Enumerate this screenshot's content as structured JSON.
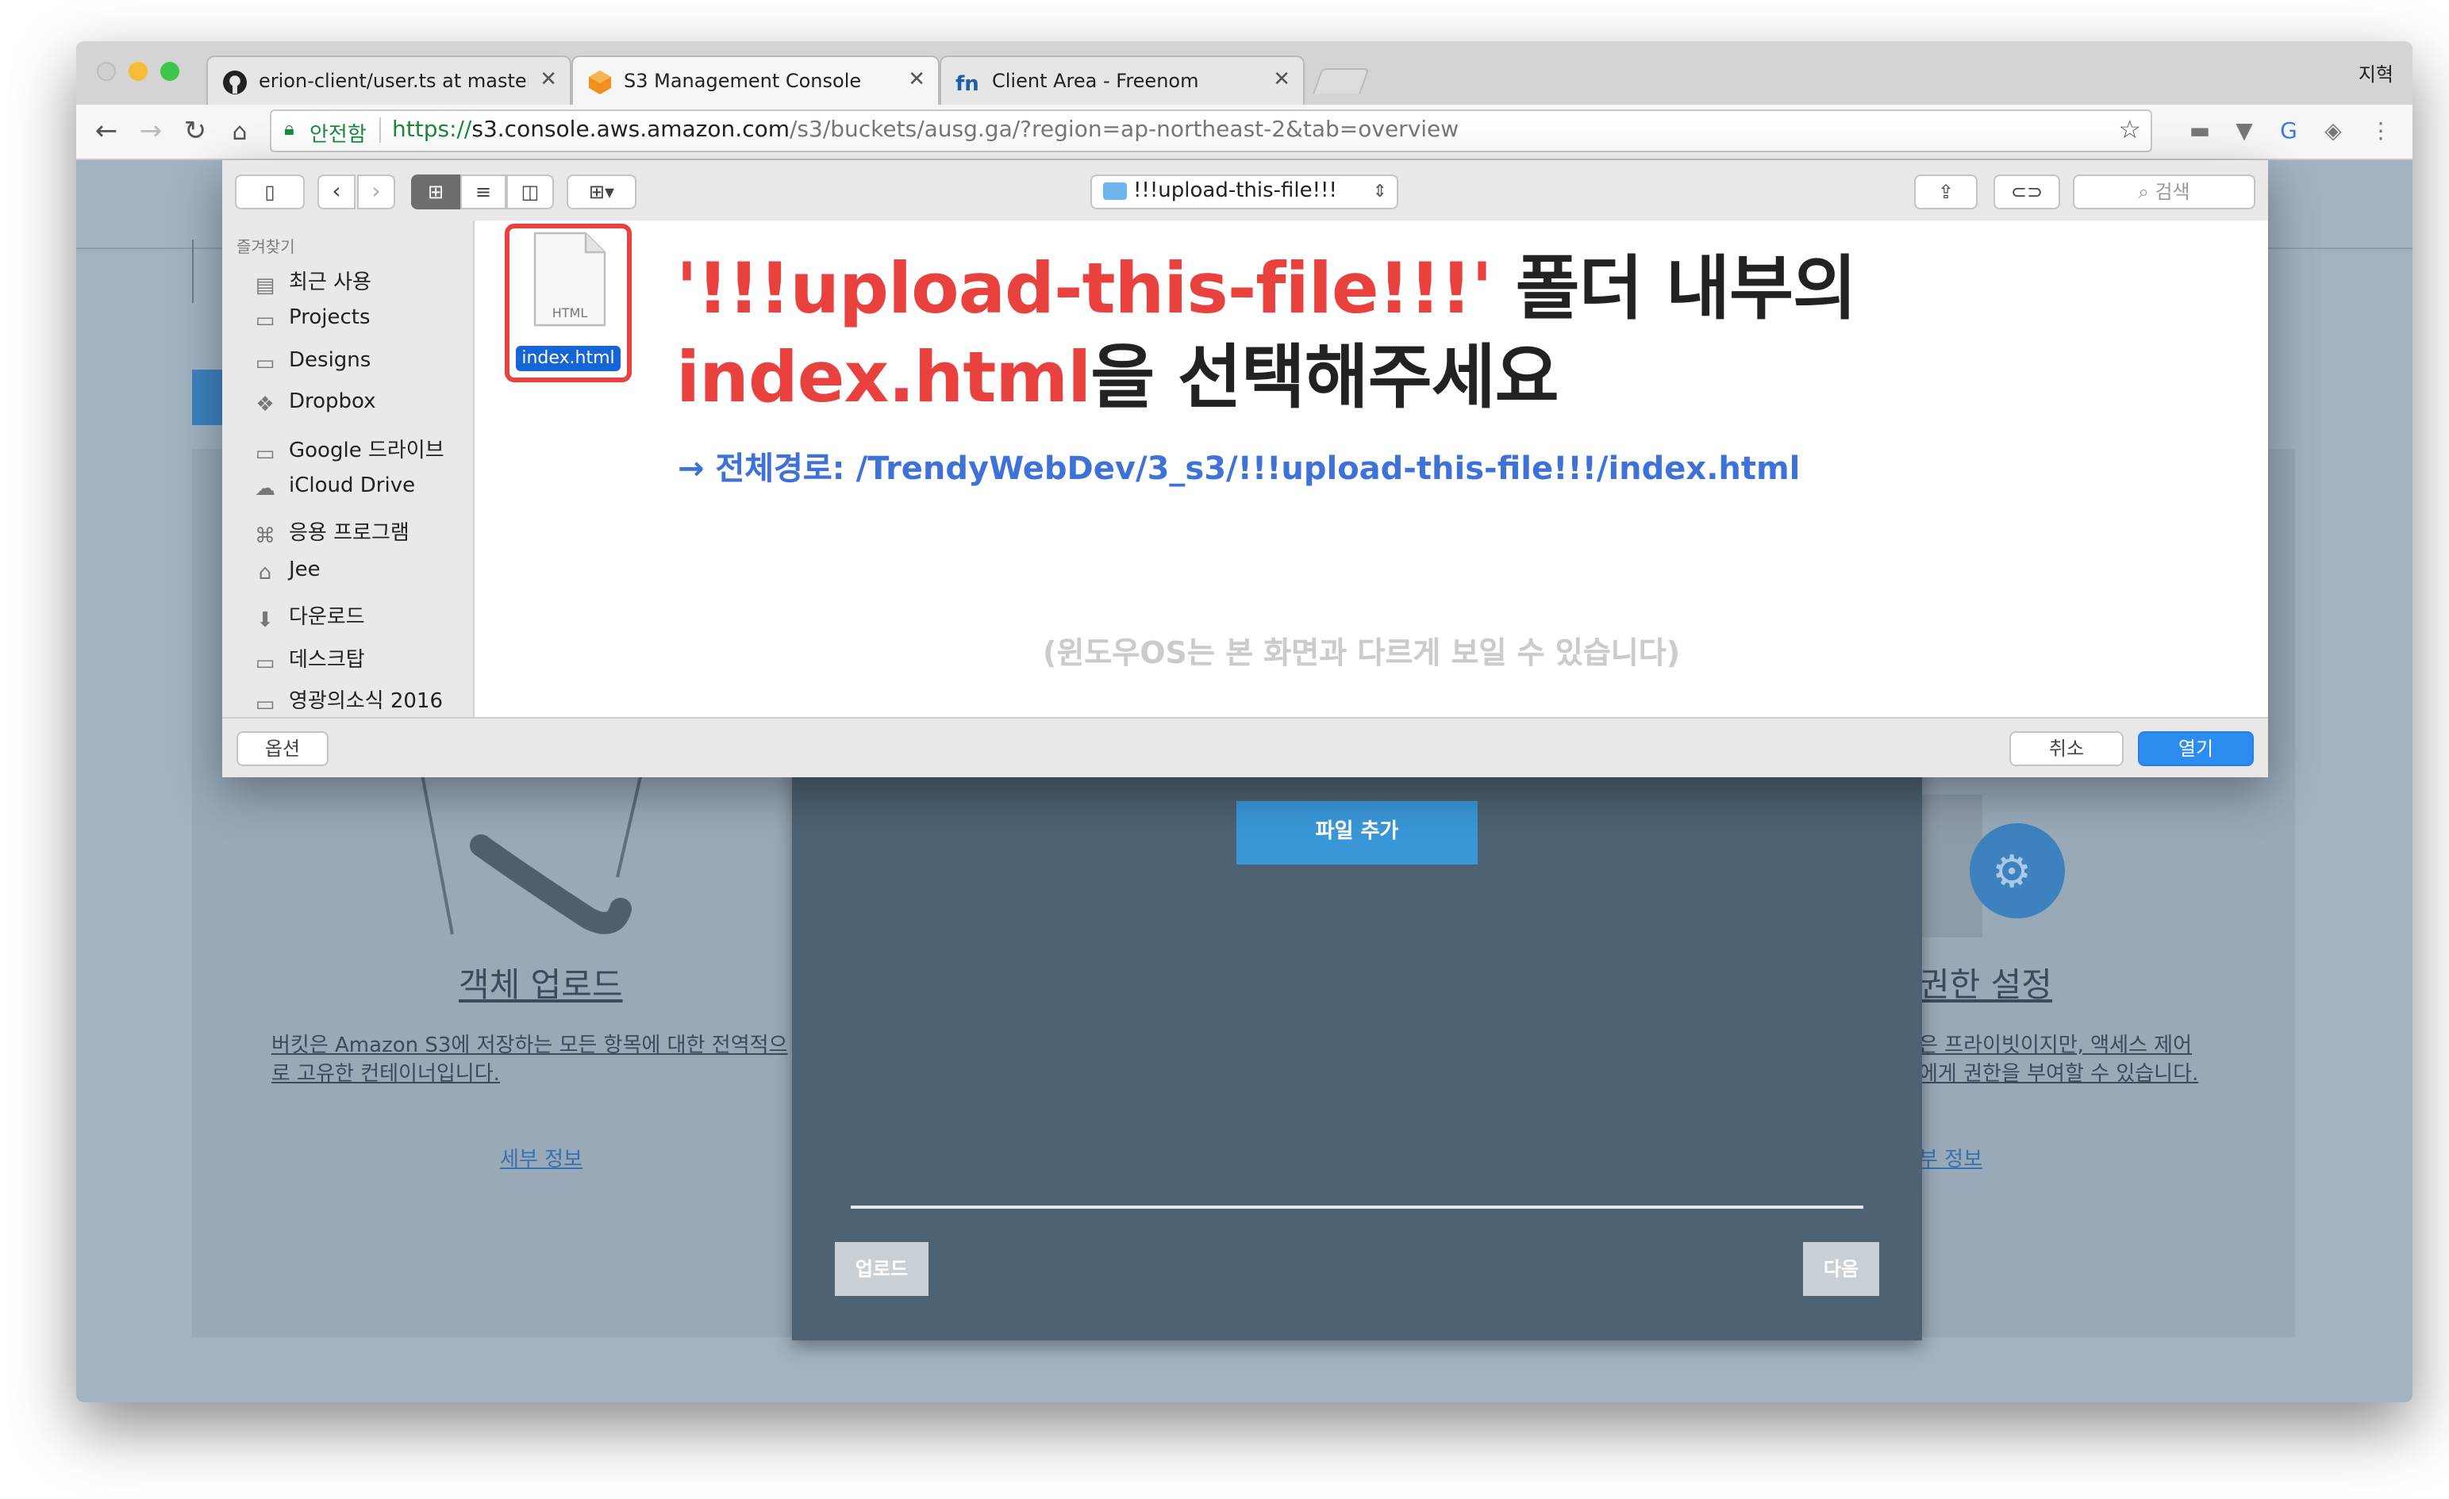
{
  "browser": {
    "tabs": [
      {
        "title": "erion-client/user.ts at master ·",
        "icon": "github-icon"
      },
      {
        "title": "S3 Management Console",
        "icon": "aws-s3-icon"
      },
      {
        "title": "Client Area - Freenom",
        "icon": "freenom-icon"
      }
    ],
    "profile_name": "지혁",
    "secure_label": "안전함",
    "url_scheme": "https://",
    "url_host": "s3.console.aws.amazon.com",
    "url_path": "/s3/buckets/ausg.ga/?region=ap-northeast-2&tab=overview"
  },
  "background_page": {
    "left_card": {
      "title": "객체 업로드",
      "desc_line1": "버킷은 Amazon S3에 저장하는 모든 항목에 대한 전역적으",
      "desc_line2": "로 고유한 컨테이너입니다.",
      "link": "세부 정보"
    },
    "right_card": {
      "title": "권한 설정",
      "desc_line1": "은 프라이빗이지만, 액세스 제어",
      "desc_line2": "에게 권한을 부여할 수 있습니다.",
      "link": "부 정보"
    },
    "modal": {
      "add_file_button": "파일 추가",
      "upload_button": "업로드",
      "next_button": "다음"
    }
  },
  "dialog": {
    "folder_name": "!!!upload-this-file!!!",
    "search_placeholder": "검색",
    "sidebar_section": "즐겨찾기",
    "sidebar_items": [
      {
        "label": "최근 사용",
        "icon": "recents-icon"
      },
      {
        "label": "Projects",
        "icon": "folder-icon"
      },
      {
        "label": "Designs",
        "icon": "folder-icon"
      },
      {
        "label": "Dropbox",
        "icon": "dropbox-icon"
      },
      {
        "label": "Google 드라이브",
        "icon": "folder-icon"
      },
      {
        "label": "iCloud Drive",
        "icon": "cloud-icon"
      },
      {
        "label": "응용 프로그램",
        "icon": "applications-icon"
      },
      {
        "label": "Jee",
        "icon": "home-icon"
      },
      {
        "label": "다운로드",
        "icon": "download-icon"
      },
      {
        "label": "데스크탑",
        "icon": "desktop-icon"
      },
      {
        "label": "영광의소식 2016",
        "icon": "folder-icon"
      }
    ],
    "file": {
      "name": "index.html",
      "type_label": "HTML"
    },
    "options_button": "옵션",
    "cancel_button": "취소",
    "open_button": "열기"
  },
  "annotation": {
    "line1_highlight": "'!!!upload-this-file!!!'",
    "line1_rest": " 폴더 내부의",
    "line2_highlight": "index.html",
    "line2_rest": "을 선택해주세요",
    "path": "→ 전체경로: /TrendyWebDev/3_s3/!!!upload-this-file!!!/index.html",
    "note": "(윈도우OS는 본 화면과 다르게 보일 수 있습니다)"
  },
  "colors": {
    "annotation_red": "#e8413e",
    "annotation_blue": "#3f72d8",
    "primary_blue": "#3a8ee6",
    "s3_orange": "#f0901e"
  }
}
